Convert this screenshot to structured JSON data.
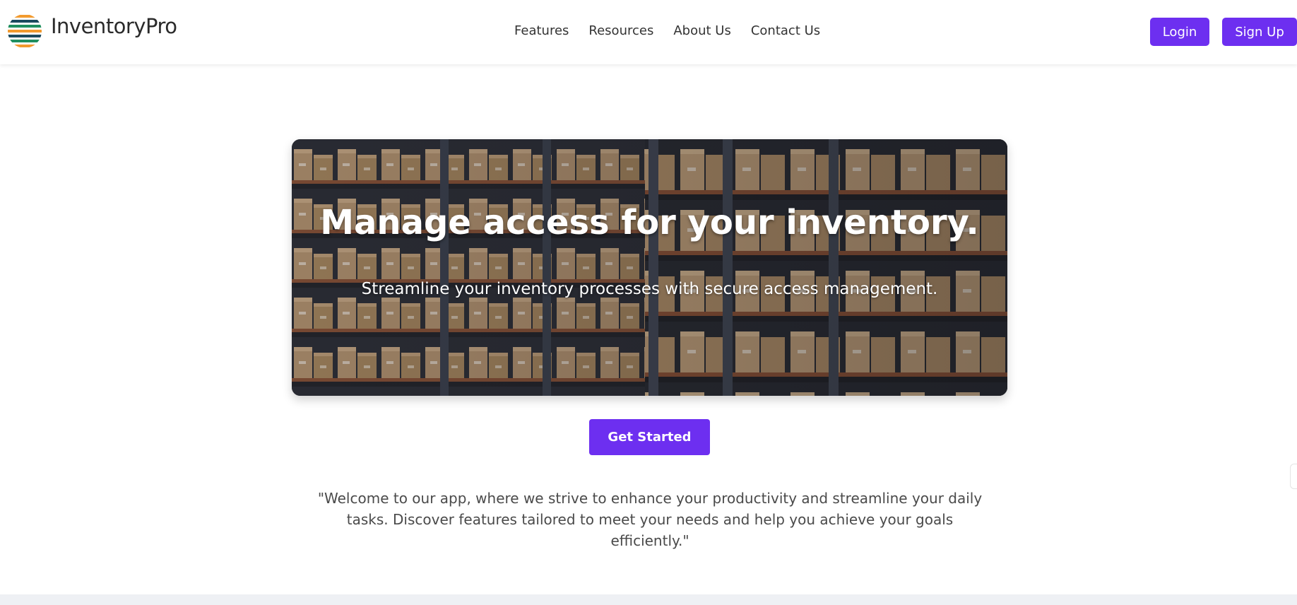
{
  "brand": {
    "name": "InventoryPro",
    "logo_icon": "striped-globe-icon",
    "logo_colors": [
      "#f29a2e",
      "#1c4a5e",
      "#1f8f5f"
    ]
  },
  "nav": {
    "items": [
      {
        "label": "Features"
      },
      {
        "label": "Resources"
      },
      {
        "label": "About Us"
      },
      {
        "label": "Contact Us"
      }
    ]
  },
  "auth": {
    "login_label": "Login",
    "signup_label": "Sign Up"
  },
  "hero": {
    "title": "Manage access for your inventory.",
    "subtitle": "Streamline your inventory processes with secure access management.",
    "background": "warehouse-shelves-image"
  },
  "cta": {
    "label": "Get Started"
  },
  "welcome": {
    "text": "\"Welcome to our app, where we strive to enhance your productivity and streamline your daily tasks. Discover features tailored to meet your needs and help you achieve your goals efficiently.\""
  },
  "colors": {
    "accent": "#6d2ff0",
    "text": "#333333"
  }
}
